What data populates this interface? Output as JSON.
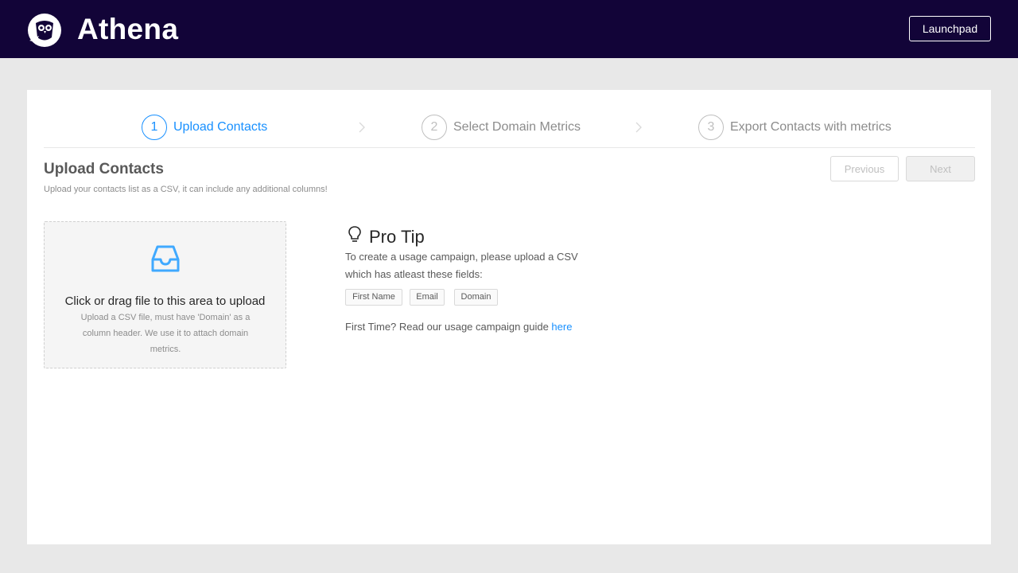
{
  "header": {
    "brand": "Athena",
    "launchpad_label": "Launchpad",
    "bg_color": "#120438"
  },
  "steps": [
    {
      "number": "1",
      "label": "Upload Contacts",
      "active": true
    },
    {
      "number": "2",
      "label": "Select Domain Metrics",
      "active": false
    },
    {
      "number": "3",
      "label": "Export Contacts with metrics",
      "active": false
    }
  ],
  "page": {
    "title": "Upload Contacts",
    "subtitle": "Upload your contacts list as a CSV, it can include any additional columns!",
    "previous_label": "Previous",
    "next_label": "Next"
  },
  "upload": {
    "icon": "inbox-icon",
    "title": "Click or drag file to this area to upload",
    "hint": "Upload a  CSV file, must have 'Domain' as a column header. We use it to attach domain metrics."
  },
  "tip": {
    "icon": "bulb-icon",
    "title": "Pro Tip",
    "text": "To create a usage campaign,  please upload a CSV which has atleast these fields:",
    "fields": [
      "First Name",
      "Email",
      "Domain"
    ],
    "guide_text": "First Time? Read our usage campaign guide ",
    "guide_link": "here"
  },
  "colors": {
    "accent": "#1890ff",
    "muted": "#bfbfbf"
  }
}
